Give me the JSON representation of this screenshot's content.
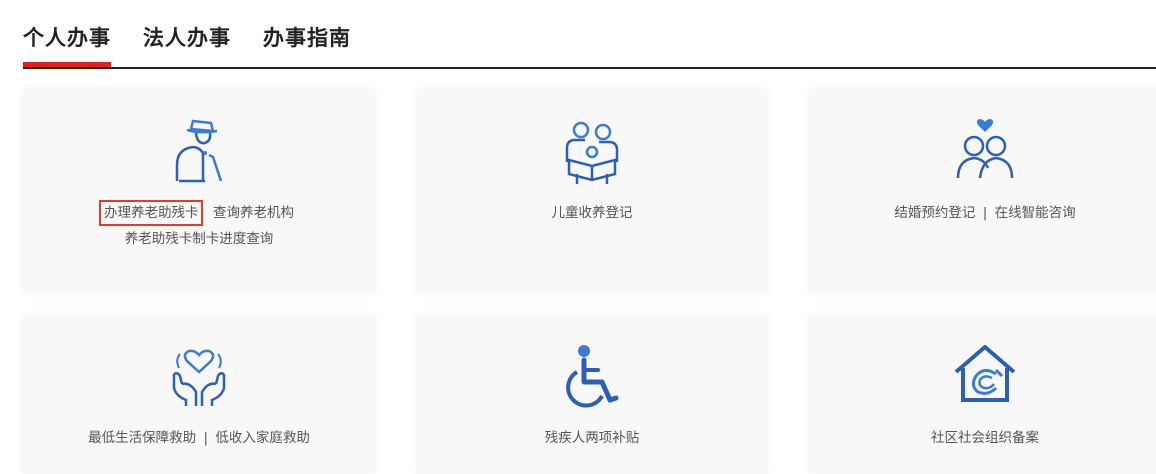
{
  "tabs": [
    {
      "label": "个人办事",
      "active": true
    },
    {
      "label": "法人办事",
      "active": false
    },
    {
      "label": "办事指南",
      "active": false
    }
  ],
  "cards": [
    {
      "icon": "elderly-person-icon",
      "links": [
        "办理养老助残卡",
        "查询养老机构",
        "养老助残卡制卡进度查询"
      ]
    },
    {
      "icon": "family-reading-icon",
      "links": [
        "儿童收养登记"
      ]
    },
    {
      "icon": "couple-heart-icon",
      "links": [
        "结婚预约登记",
        "在线智能咨询"
      ],
      "separator": "|"
    },
    {
      "icon": "heart-hands-icon",
      "links": [
        "最低生活保障救助",
        "低收入家庭救助"
      ],
      "separator": "|"
    },
    {
      "icon": "wheelchair-icon",
      "links": [
        "残疾人两项补贴"
      ]
    },
    {
      "icon": "community-house-icon",
      "links": [
        "社区社会组织备案"
      ]
    }
  ],
  "colors": {
    "accent": "#e0211b",
    "icon_blue": "#2b5fb8",
    "icon_light_blue": "#3a7bd5"
  }
}
